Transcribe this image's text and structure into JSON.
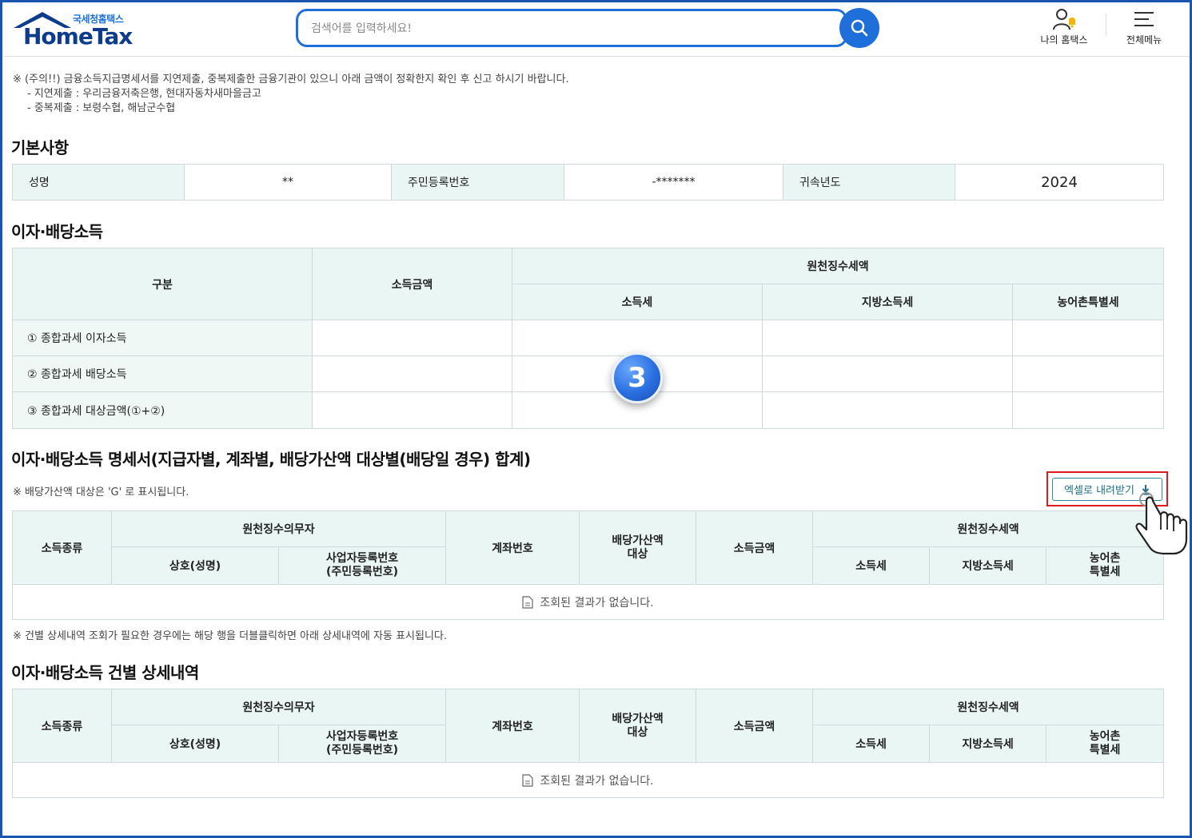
{
  "header": {
    "logo_small": "국세청홈택스",
    "logo_big": "HomeTax",
    "search_placeholder": "검색어를 입력하세요!",
    "my_hometax": "나의 홈택스",
    "all_menu": "전체메뉴"
  },
  "notice": {
    "line1": "※ (주의!!) 금융소득지급명세서를 지연제출, 중복제출한 금융기관이 있으니 아래 금액이 정확한지 확인 후 신고 하시기 바랍니다.",
    "line2": "- 지연제출 : 우리금융저축은행, 현대자동차새마을금고",
    "line3": "- 중복제출 : 보령수협, 해남군수협"
  },
  "basic": {
    "title": "기본사항",
    "name_label": "성명",
    "name_value": "**",
    "rrn_label": "주민등록번호",
    "rrn_value": "-*******",
    "year_label": "귀속년도",
    "year_value": "2024"
  },
  "income": {
    "title": "이자·배당소득",
    "col_category": "구분",
    "col_amount": "소득금액",
    "col_withholding": "원천징수세액",
    "col_income_tax": "소득세",
    "col_local_tax": "지방소득세",
    "col_rural_tax": "농어촌특별세",
    "rows": [
      "① 종합과세 이자소득",
      "② 종합과세 배당소득",
      "③ 종합과세 대상금액(①+②)"
    ]
  },
  "badge": "3",
  "statement": {
    "title": "이자·배당소득 명세서(지급자별, 계좌별, 배당가산액 대상별(배당일 경우) 합계)",
    "note": "※ 배당가산액 대상은 'G' 로 표시됩니다.",
    "excel_button": "엑셀로 내려받기",
    "empty": "조회된 결과가 없습니다.",
    "after_note": "※ 건별 상세내역 조회가 필요한 경우에는 해당 행을 더블클릭하면 아래 상세내역에 자동 표시됩니다."
  },
  "detail": {
    "title": "이자·배당소득 건별 상세내역",
    "empty": "조회된 결과가 없습니다."
  },
  "columns": {
    "income_type": "소득종류",
    "withholder": "원천징수의무자",
    "company": "상호(성명)",
    "bizno_line1": "사업자등록번호",
    "bizno_line2": "(주민등록번호)",
    "account": "계좌번호",
    "dividend_line1": "배당가산액",
    "dividend_line2": "대상",
    "amount": "소득금액",
    "withholding": "원천징수세액",
    "income_tax": "소득세",
    "local_tax": "지방소득세",
    "rural_line1": "농어촌",
    "rural_line2": "특별세"
  }
}
